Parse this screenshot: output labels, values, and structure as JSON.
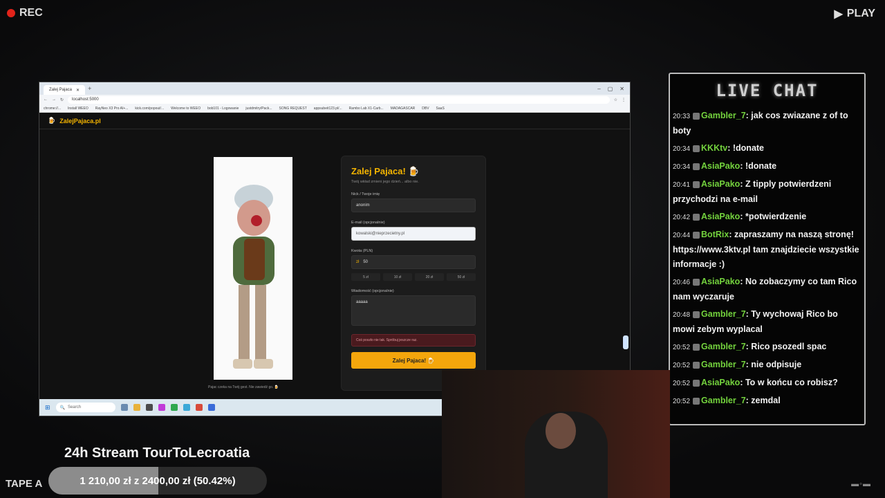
{
  "overlay": {
    "rec_label": "REC",
    "play_label": "PLAY",
    "tape_label": "TAPE A",
    "stream_title": "24h Stream TourToLecroatia",
    "goal_text": "1 210,00 zł z 2400,00 zł (50.42%)",
    "goal_progress": 0.5042
  },
  "browser": {
    "tab_title": "Zalej Pajaca",
    "url": "localhost:5000",
    "bookmarks": [
      "chrome://...",
      "Install WEEO",
      "RayNeo X3 Pro AI+...",
      "kick.com/popout/...",
      "Welcome to WEEO",
      "bob101 - Logowanie",
      "justdmitry/Pack...",
      "SONG REQUEST",
      "appsubeit123.pl/...",
      "Rambo Lab X1-Carb...",
      "MADAGASCAR",
      "DBV",
      "SaaS"
    ]
  },
  "site": {
    "brand": "ZalejPajaca.pl",
    "caption": "Pajac czeka na Twój gest. Nie zawiedź go. 🍺",
    "form": {
      "title": "Zalej Pajaca! 🍺",
      "subtitle": "Twój wkład zmieni jego dzień... albo nie.",
      "nick_label": "Nick / Twoje imię",
      "nick_value": "anonim",
      "email_label": "E-mail (opcjonalnie)",
      "email_value": "kowalski@nieprzecietny.pl",
      "amount_label": "Kwota (PLN)",
      "amount_currency": "zł",
      "amount_value": "50",
      "quick_amounts": [
        "5 zł",
        "10 zł",
        "20 zł",
        "50 zł"
      ],
      "message_label": "Wiadomość (opcjonalnie)",
      "message_value": "aaaaa",
      "error_text": "Coś poszło nie tak. Spróbuj jeszcze raz.",
      "submit_label": "Zalej Pajaca! 🍺"
    }
  },
  "taskbar": {
    "search_placeholder": "Search"
  },
  "chat": {
    "title": "LIVE CHAT",
    "messages": [
      {
        "time": "20:33",
        "user": "Gambler_7",
        "text": ": jak cos zwiazane z of to boty"
      },
      {
        "time": "20:34",
        "user": "KKKtv",
        "text": ": !donate"
      },
      {
        "time": "20:34",
        "user": "AsiaPako",
        "text": ": !donate"
      },
      {
        "time": "20:41",
        "user": "AsiaPako",
        "text": ": Z tipply potwierdzeni przychodzi na e-mail"
      },
      {
        "time": "20:42",
        "user": "AsiaPako",
        "text": ": *potwierdzenie"
      },
      {
        "time": "20:44",
        "user": "BotRix",
        "text": ": zapraszamy na naszą stronę! https://www.3ktv.pl tam znajdziecie wszystkie informacje :)"
      },
      {
        "time": "20:46",
        "user": "AsiaPako",
        "text": ": No zobaczymy co tam Rico nam wyczaruje"
      },
      {
        "time": "20:48",
        "user": "Gambler_7",
        "text": ": Ty wychowaj Rico bo mowi zebym wyplacal"
      },
      {
        "time": "20:52",
        "user": "Gambler_7",
        "text": ": Rico psozedl spac"
      },
      {
        "time": "20:52",
        "user": "Gambler_7",
        "text": ": nie odpisuje"
      },
      {
        "time": "20:52",
        "user": "AsiaPako",
        "text": ": To w końcu co robisz?"
      },
      {
        "time": "20:52",
        "user": "Gambler_7",
        "text": ": zemdal"
      }
    ]
  }
}
